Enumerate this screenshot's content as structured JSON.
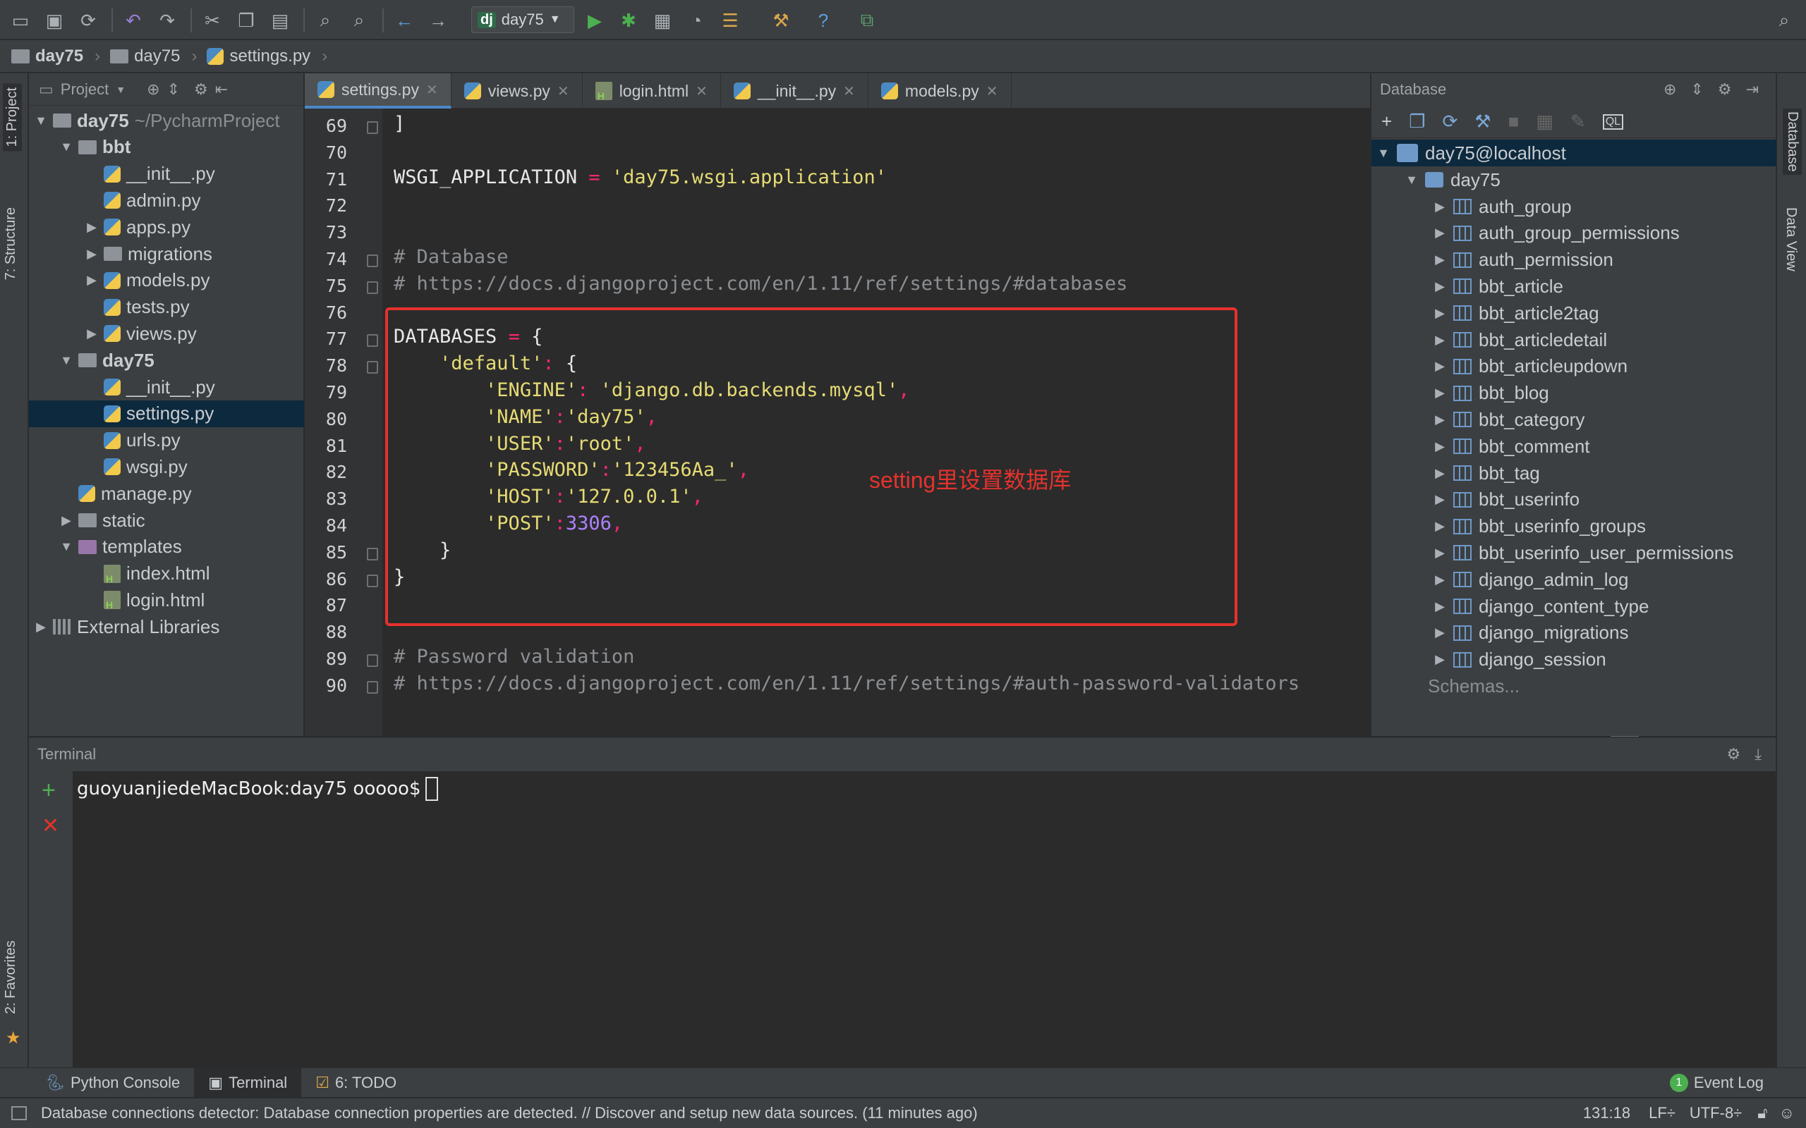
{
  "toolbar": {
    "run_config": "day75",
    "run_config_badge": "dj"
  },
  "breadcrumb": [
    "day75",
    "day75",
    "settings.py"
  ],
  "project_panel": {
    "title": "Project",
    "tree": [
      {
        "label": "day75",
        "suffix": "~/PycharmProject",
        "type": "folder",
        "arrow": "▼"
      },
      {
        "label": "bbt",
        "type": "folder",
        "arrow": "▼"
      },
      {
        "label": "__init__.py",
        "type": "py",
        "arrow": ""
      },
      {
        "label": "admin.py",
        "type": "py",
        "arrow": ""
      },
      {
        "label": "apps.py",
        "type": "py",
        "arrow": "▶"
      },
      {
        "label": "migrations",
        "type": "folder",
        "arrow": "▶"
      },
      {
        "label": "models.py",
        "type": "py",
        "arrow": "▶"
      },
      {
        "label": "tests.py",
        "type": "py",
        "arrow": ""
      },
      {
        "label": "views.py",
        "type": "py",
        "arrow": "▶"
      },
      {
        "label": "day75",
        "type": "folder",
        "arrow": "▼"
      },
      {
        "label": "__init__.py",
        "type": "py",
        "arrow": ""
      },
      {
        "label": "settings.py",
        "type": "py",
        "arrow": ""
      },
      {
        "label": "urls.py",
        "type": "py",
        "arrow": ""
      },
      {
        "label": "wsgi.py",
        "type": "py",
        "arrow": ""
      },
      {
        "label": "manage.py",
        "type": "py",
        "arrow": ""
      },
      {
        "label": "static",
        "type": "folder",
        "arrow": "▶"
      },
      {
        "label": "templates",
        "type": "folder-purple",
        "arrow": "▼"
      },
      {
        "label": "index.html",
        "type": "html",
        "arrow": ""
      },
      {
        "label": "login.html",
        "type": "html",
        "arrow": ""
      },
      {
        "label": "External Libraries",
        "type": "lib",
        "arrow": "▶"
      }
    ]
  },
  "editor_tabs": [
    {
      "label": "settings.py",
      "type": "py",
      "active": true
    },
    {
      "label": "views.py",
      "type": "py",
      "active": false
    },
    {
      "label": "login.html",
      "type": "html",
      "active": false
    },
    {
      "label": "__init__.py",
      "type": "py",
      "active": false
    },
    {
      "label": "models.py",
      "type": "py",
      "active": false
    }
  ],
  "code": {
    "line_numbers": [
      "69",
      "70",
      "71",
      "72",
      "73",
      "74",
      "75",
      "76",
      "77",
      "78",
      "79",
      "80",
      "81",
      "82",
      "83",
      "84",
      "85",
      "86",
      "87",
      "88",
      "89",
      "90"
    ],
    "lines": [
      {
        "n": "69",
        "parts": [
          {
            "c": "pl",
            "t": "]"
          }
        ]
      },
      {
        "n": "70",
        "parts": []
      },
      {
        "n": "71",
        "parts": [
          {
            "c": "pl",
            "t": "WSGI_APPLICATION "
          },
          {
            "c": "op",
            "t": "="
          },
          {
            "c": "str",
            "t": " 'day75.wsgi.application'"
          }
        ]
      },
      {
        "n": "72",
        "parts": []
      },
      {
        "n": "73",
        "parts": []
      },
      {
        "n": "74",
        "parts": [
          {
            "c": "com",
            "t": "# Database"
          }
        ]
      },
      {
        "n": "75",
        "parts": [
          {
            "c": "com",
            "t": "# https://docs.djangoproject.com/en/1.11/ref/settings/#databases"
          }
        ]
      },
      {
        "n": "76",
        "parts": []
      },
      {
        "n": "77",
        "parts": [
          {
            "c": "pl",
            "t": "DATABASES "
          },
          {
            "c": "op",
            "t": "="
          },
          {
            "c": "pl",
            "t": " {"
          }
        ]
      },
      {
        "n": "78",
        "parts": [
          {
            "c": "pl",
            "t": "    "
          },
          {
            "c": "str",
            "t": "'default'"
          },
          {
            "c": "op",
            "t": ":"
          },
          {
            "c": "pl",
            "t": " {"
          }
        ]
      },
      {
        "n": "79",
        "parts": [
          {
            "c": "pl",
            "t": "        "
          },
          {
            "c": "str",
            "t": "'ENGINE'"
          },
          {
            "c": "op",
            "t": ":"
          },
          {
            "c": "str",
            "t": " 'django.db.backends.mysql'"
          },
          {
            "c": "op",
            "t": ","
          }
        ]
      },
      {
        "n": "80",
        "parts": [
          {
            "c": "pl",
            "t": "        "
          },
          {
            "c": "str",
            "t": "'NAME'"
          },
          {
            "c": "op",
            "t": ":"
          },
          {
            "c": "str",
            "t": "'day75'"
          },
          {
            "c": "op",
            "t": ","
          }
        ]
      },
      {
        "n": "81",
        "parts": [
          {
            "c": "pl",
            "t": "        "
          },
          {
            "c": "str",
            "t": "'USER'"
          },
          {
            "c": "op",
            "t": ":"
          },
          {
            "c": "str",
            "t": "'root'"
          },
          {
            "c": "op",
            "t": ","
          }
        ]
      },
      {
        "n": "82",
        "parts": [
          {
            "c": "pl",
            "t": "        "
          },
          {
            "c": "str",
            "t": "'PASSWORD'"
          },
          {
            "c": "op",
            "t": ":"
          },
          {
            "c": "str",
            "t": "'123456Aa_'"
          },
          {
            "c": "op",
            "t": ","
          }
        ]
      },
      {
        "n": "83",
        "parts": [
          {
            "c": "pl",
            "t": "        "
          },
          {
            "c": "str",
            "t": "'HOST'"
          },
          {
            "c": "op",
            "t": ":"
          },
          {
            "c": "str",
            "t": "'127.0.0.1'"
          },
          {
            "c": "op",
            "t": ","
          }
        ]
      },
      {
        "n": "84",
        "parts": [
          {
            "c": "pl",
            "t": "        "
          },
          {
            "c": "str",
            "t": "'POST'"
          },
          {
            "c": "op",
            "t": ":"
          },
          {
            "c": "num",
            "t": "3306"
          },
          {
            "c": "op",
            "t": ","
          }
        ]
      },
      {
        "n": "85",
        "parts": [
          {
            "c": "pl",
            "t": "    }"
          }
        ]
      },
      {
        "n": "86",
        "parts": [
          {
            "c": "pl",
            "t": "}"
          }
        ]
      },
      {
        "n": "87",
        "parts": []
      },
      {
        "n": "88",
        "parts": []
      },
      {
        "n": "89",
        "parts": [
          {
            "c": "com",
            "t": "# Password validation"
          }
        ]
      },
      {
        "n": "90",
        "parts": [
          {
            "c": "com",
            "t": "# https://docs.djangoproject.com/en/1.11/ref/settings/#auth-password-validators"
          }
        ]
      }
    ]
  },
  "annotation": "setting里设置数据库",
  "database_panel": {
    "title": "Database",
    "connection": "day75@localhost",
    "schema": "day75",
    "tables": [
      "auth_group",
      "auth_group_permissions",
      "auth_permission",
      "bbt_article",
      "bbt_article2tag",
      "bbt_articledetail",
      "bbt_articleupdown",
      "bbt_blog",
      "bbt_category",
      "bbt_comment",
      "bbt_tag",
      "bbt_userinfo",
      "bbt_userinfo_groups",
      "bbt_userinfo_user_permissions",
      "django_admin_log",
      "django_content_type",
      "django_migrations",
      "django_session"
    ],
    "schemas_link": "Schemas..."
  },
  "left_strip": {
    "project": "1: Project",
    "structure": "7: Structure",
    "favorites": "2: Favorites"
  },
  "right_strip": {
    "database": "Database",
    "data_view": "Data View"
  },
  "terminal": {
    "title": "Terminal",
    "prompt": "guoyuanjiedeMacBook:day75 ooooo$"
  },
  "bottom_tabs": [
    {
      "label": "Python Console",
      "active": false
    },
    {
      "label": "Terminal",
      "active": true
    },
    {
      "label": "6: TODO",
      "active": false
    }
  ],
  "event_log": {
    "count": "1",
    "label": "Event Log"
  },
  "status_bar": {
    "message": "Database connections detector: Database connection properties are detected. // Discover and setup new data sources. (11 minutes ago)",
    "position": "131:18",
    "line_sep": "LF÷",
    "encoding": "UTF-8÷"
  }
}
